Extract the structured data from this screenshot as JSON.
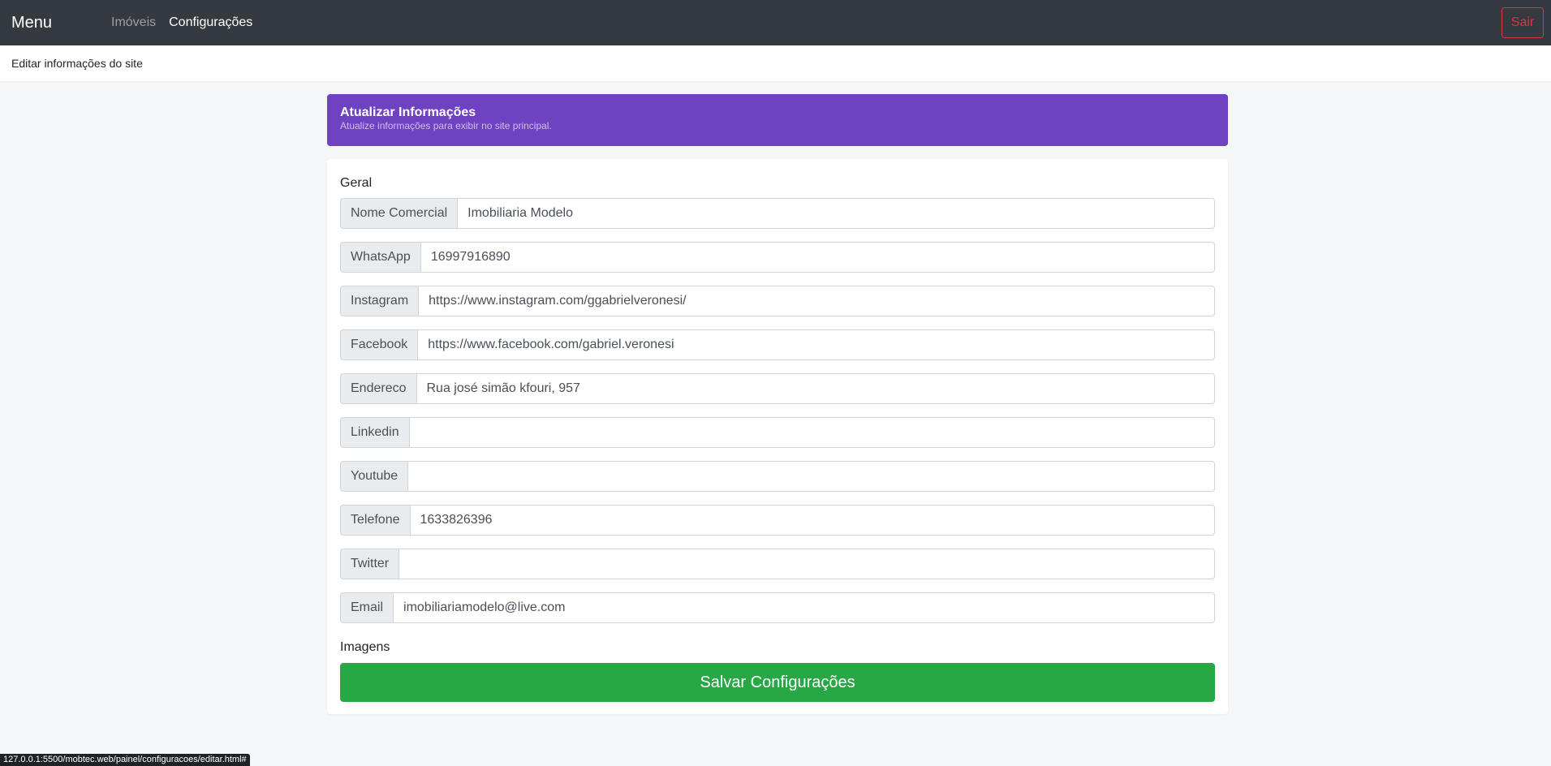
{
  "navbar": {
    "brand": "Menu",
    "links": [
      {
        "label": "Imóveis",
        "active": false
      },
      {
        "label": "Configurações",
        "active": true
      }
    ],
    "logout_label": "Sair"
  },
  "subheader": {
    "title": "Editar informações do site"
  },
  "banner": {
    "title": "Atualizar Informações",
    "subtitle": "Atualize informações para exibir no site principal.",
    "color": "#6f42c1"
  },
  "form": {
    "section_general": "Geral",
    "fields": [
      {
        "label": "Nome Comercial",
        "value": "Imobiliaria Modelo"
      },
      {
        "label": "WhatsApp",
        "value": "16997916890"
      },
      {
        "label": "Instagram",
        "value": "https://www.instagram.com/ggabrielveronesi/"
      },
      {
        "label": "Facebook",
        "value": "https://www.facebook.com/gabriel.veronesi"
      },
      {
        "label": "Endereco",
        "value": "Rua josé simão kfouri, 957"
      },
      {
        "label": "Linkedin",
        "value": ""
      },
      {
        "label": "Youtube",
        "value": ""
      },
      {
        "label": "Telefone",
        "value": "1633826396"
      },
      {
        "label": "Twitter",
        "value": ""
      },
      {
        "label": "Email",
        "value": "imobiliariamodelo@live.com"
      }
    ],
    "section_images": "Imagens",
    "save_label": "Salvar Configurações",
    "save_color": "#28a745"
  },
  "status_bar": {
    "url": "127.0.0.1:5500/mobtec.web/painel/configuracoes/editar.html#"
  }
}
